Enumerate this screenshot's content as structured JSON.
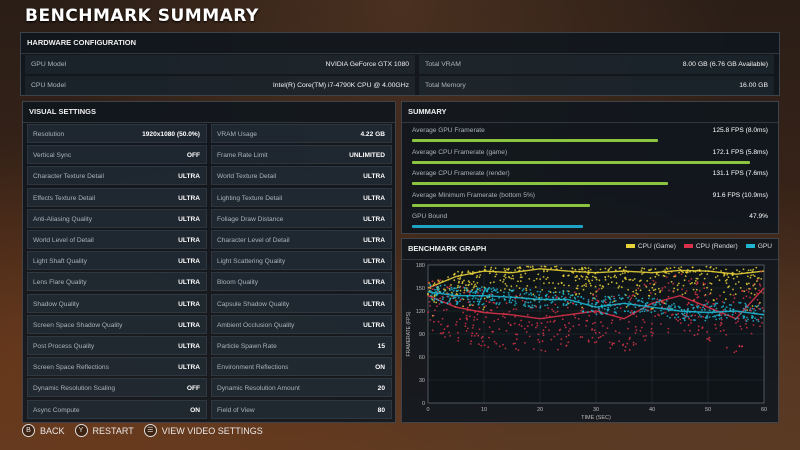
{
  "title": "BENCHMARK SUMMARY",
  "hardware": {
    "header": "HARDWARE CONFIGURATION",
    "gpu_model_label": "GPU Model",
    "gpu_model": "NVIDIA GeForce GTX 1080",
    "cpu_model_label": "CPU Model",
    "cpu_model": "Intel(R) Core(TM) i7-4790K CPU @ 4.00GHz",
    "vram_label": "Total VRAM",
    "vram": "8.00 GB (6.76 GB Available)",
    "memory_label": "Total Memory",
    "memory": "16.00 GB"
  },
  "visual": {
    "header": "VISUAL SETTINGS",
    "left": [
      {
        "label": "Resolution",
        "value": "1920x1080 (50.0%)"
      },
      {
        "label": "Vertical Sync",
        "value": "OFF"
      },
      {
        "label": "Character Texture Detail",
        "value": "ULTRA"
      },
      {
        "label": "Effects Texture Detail",
        "value": "ULTRA"
      },
      {
        "label": "Anti-Aliasing Quality",
        "value": "ULTRA"
      },
      {
        "label": "World Level of Detail",
        "value": "ULTRA"
      },
      {
        "label": "Light Shaft Quality",
        "value": "ULTRA"
      },
      {
        "label": "Lens Flare Quality",
        "value": "ULTRA"
      },
      {
        "label": "Shadow Quality",
        "value": "ULTRA"
      },
      {
        "label": "Screen Space Shadow Quality",
        "value": "ULTRA"
      },
      {
        "label": "Post Process Quality",
        "value": "ULTRA"
      },
      {
        "label": "Screen Space Reflections",
        "value": "ULTRA"
      },
      {
        "label": "Dynamic Resolution Scaling",
        "value": "OFF"
      },
      {
        "label": "Async Compute",
        "value": "ON"
      }
    ],
    "right": [
      {
        "label": "VRAM Usage",
        "value": "4.22 GB"
      },
      {
        "label": "Frame Rate Limit",
        "value": "UNLIMITED"
      },
      {
        "label": "World Texture Detail",
        "value": "ULTRA"
      },
      {
        "label": "Lighting Texture Detail",
        "value": "ULTRA"
      },
      {
        "label": "Foliage Draw Distance",
        "value": "ULTRA"
      },
      {
        "label": "Character Level of Detail",
        "value": "ULTRA"
      },
      {
        "label": "Light Scattering Quality",
        "value": "ULTRA"
      },
      {
        "label": "Bloom Quality",
        "value": "ULTRA"
      },
      {
        "label": "Capsule Shadow Quality",
        "value": "ULTRA"
      },
      {
        "label": "Ambient Occlusion Quality",
        "value": "ULTRA"
      },
      {
        "label": "Particle Spawn Rate",
        "value": "15"
      },
      {
        "label": "Environment Reflections",
        "value": "ON"
      },
      {
        "label": "Dynamic Resolution Amount",
        "value": "20"
      },
      {
        "label": "Field of View",
        "value": "80"
      }
    ]
  },
  "summary": {
    "header": "SUMMARY",
    "rows": [
      {
        "label": "Average GPU Framerate",
        "value": "125.8 FPS (8.0ms)",
        "fill": 0.69,
        "color": "#8bc53f"
      },
      {
        "label": "Average CPU Framerate (game)",
        "value": "172.1 FPS (5.8ms)",
        "fill": 0.95,
        "color": "#8bc53f"
      },
      {
        "label": "Average CPU Framerate (render)",
        "value": "131.1 FPS (7.6ms)",
        "fill": 0.72,
        "color": "#8bc53f"
      },
      {
        "label": "Average Minimum Framerate (bottom 5%)",
        "value": "91.6 FPS (10.9ms)",
        "fill": 0.5,
        "color": "#8bc53f"
      },
      {
        "label": "GPU Bound",
        "value": "47.9%",
        "fill": 0.479,
        "color": "#1fa3c4"
      }
    ]
  },
  "graph": {
    "header": "BENCHMARK GRAPH",
    "legend": [
      {
        "name": "CPU (Game)",
        "color": "#e8d23a"
      },
      {
        "name": "CPU (Render)",
        "color": "#d8324a"
      },
      {
        "name": "GPU",
        "color": "#1fb5cf"
      }
    ]
  },
  "chart_data": {
    "type": "scatter",
    "title": "BENCHMARK GRAPH",
    "xlabel": "TIME (SEC)",
    "ylabel": "FRAMERATE (FPS)",
    "xlim": [
      0,
      60
    ],
    "ylim": [
      0,
      180
    ],
    "xticks": [
      0,
      10,
      20,
      30,
      40,
      50,
      60
    ],
    "yticks": [
      0,
      30,
      60,
      90,
      120,
      150,
      180
    ],
    "series": [
      {
        "name": "CPU (Game)",
        "color": "#e8d23a",
        "x": [
          0,
          5,
          10,
          15,
          20,
          25,
          30,
          35,
          40,
          45,
          50,
          55,
          60
        ],
        "y": [
          150,
          165,
          172,
          170,
          175,
          172,
          170,
          172,
          170,
          173,
          172,
          168,
          172
        ]
      },
      {
        "name": "CPU (Render)",
        "color": "#d8324a",
        "x": [
          0,
          5,
          10,
          15,
          20,
          25,
          30,
          35,
          40,
          45,
          50,
          55,
          60
        ],
        "y": [
          140,
          125,
          118,
          115,
          110,
          115,
          120,
          110,
          130,
          140,
          125,
          110,
          150
        ]
      },
      {
        "name": "GPU",
        "color": "#1fb5cf",
        "x": [
          0,
          5,
          10,
          15,
          20,
          25,
          30,
          35,
          40,
          45,
          50,
          55,
          60
        ],
        "y": [
          145,
          140,
          140,
          138,
          135,
          135,
          125,
          130,
          125,
          120,
          118,
          120,
          115
        ]
      }
    ]
  },
  "footer": [
    {
      "key": "B",
      "label": "BACK"
    },
    {
      "key": "Y",
      "label": "RESTART"
    },
    {
      "key": "☰",
      "label": "VIEW VIDEO SETTINGS"
    }
  ]
}
